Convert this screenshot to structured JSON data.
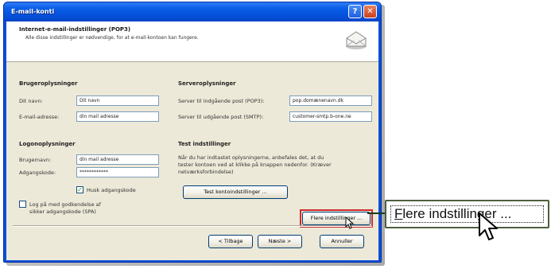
{
  "window": {
    "title": "E-mail-konti",
    "help_glyph": "?",
    "close_glyph": "✕"
  },
  "header": {
    "title": "Internet-e-mail-indstillinger (POP3)",
    "description": "Alle disse indstillinger er nødvendige, for at e-mail-kontoen kan fungere.",
    "icon": "envelope-gear-icon"
  },
  "user_info": {
    "title": "Brugeroplysninger",
    "name_label": "Dit navn:",
    "name_value": "Dit navn",
    "email_label": "E-mail-adresse:",
    "email_value": "din mail adresse"
  },
  "logon_info": {
    "title": "Logonoplysninger",
    "username_label": "Brugernavn:",
    "username_value": "din mail adresse",
    "password_label": "Adgangskode:",
    "password_value": "************",
    "remember_label": "Husk adgangskode",
    "remember_checked": true,
    "spa_label_line1": "Log på med godkendelse af",
    "spa_label_line2": "sikker adgangskode (SPA)",
    "spa_checked": false
  },
  "server_info": {
    "title": "Serveroplysninger",
    "incoming_label": "Server til indgående post (POP3):",
    "incoming_value": "pop.domænenavn.dk",
    "outgoing_label": "Server til udgående post (SMTP):",
    "outgoing_value": "customer-smtp.b-one.ne"
  },
  "test_settings": {
    "title": "Test indstillinger",
    "desc_line1": "Når du har indtastet oplysningerne, anbefales det, at du",
    "desc_line2": "tester kontoen ved at klikke på knappen nedenfor. (Kræver",
    "desc_line3": "netværksforbindelse)",
    "test_button": "Test kontoindstillinger ..."
  },
  "more_settings_button": "Flere indstillinger ...",
  "footer": {
    "back_button": "< Tilbage",
    "next_button": "Næste >",
    "cancel_button": "Annuller"
  },
  "zoom_callout": {
    "label_prefix": "F",
    "label_rest": "lere indstillinger ..."
  },
  "colors": {
    "titlebar": "#0a5fe8",
    "dialog_bg": "#ece9d8",
    "highlight": "#d12a2a"
  }
}
